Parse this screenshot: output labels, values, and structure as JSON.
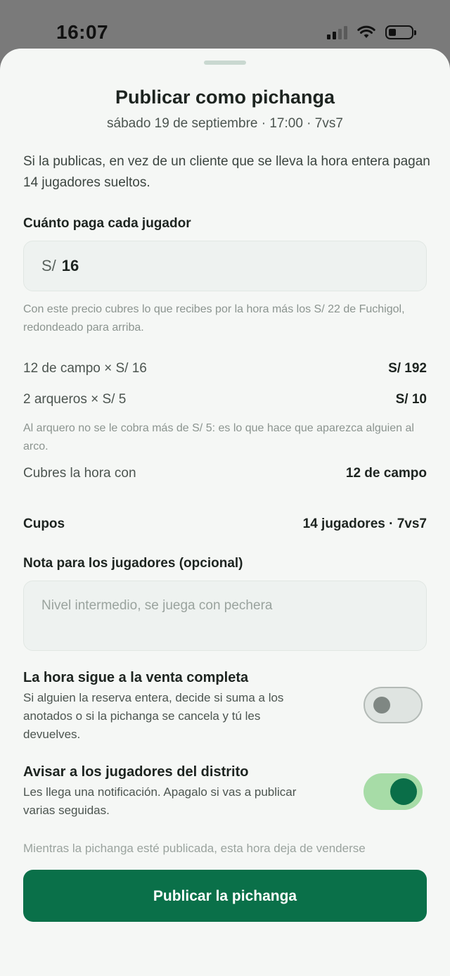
{
  "status": {
    "time": "16:07",
    "icons": [
      "signal-icon",
      "wifi-icon",
      "battery-icon"
    ]
  },
  "sheet": {
    "title": "Publicar como pichanga",
    "subtitle": "sábado 19 de septiembre · 17:00 · 7vs7",
    "intro": "Si la publicas, en vez de un cliente que se lleva la hora entera pagan 14 jugadores sueltos.",
    "price": {
      "label": "Cuánto paga cada jugador",
      "prefix": "S/",
      "value": "16",
      "help": "Con este precio cubres lo que recibes por la hora más los S/ 22 de Fuchigol, redondeado para arriba."
    },
    "breakdown": {
      "field_label": "12 de campo × S/ 16",
      "field_total": "S/ 192",
      "keepers_label": "2 arqueros × S/ 5",
      "keepers_total": "S/ 10",
      "keeper_help": "Al arquero no se le cobra más de S/ 5: es lo que hace que aparezca alguien al arco.",
      "cover_label": "Cubres la hora con",
      "cover_value": "12 de campo"
    },
    "spots": {
      "label": "Cupos",
      "value": "14 jugadores · 7vs7"
    },
    "note": {
      "label": "Nota para los jugadores (opcional)",
      "placeholder": "Nivel intermedio, se juega con pechera"
    },
    "toggles": [
      {
        "title": "La hora sigue a la venta completa",
        "desc": "Si alguien la reserva entera, decide si suma a los anotados o si la pichanga se cancela y tú les devuelves.",
        "state": "off"
      },
      {
        "title": "Avisar a los jugadores del distrito",
        "desc": "Les llega una notificación. Apagalo si vas a publicar varias seguidas.",
        "state": "on"
      }
    ],
    "footer_note": "Mientras la pichanga esté publicada, esta hora deja de venderse",
    "cta": "Publicar la pichanga"
  },
  "colors": {
    "accent": "#0a7049",
    "toggle_on_track": "#a7dca7",
    "toggle_on_knob": "#0a6e48",
    "background": "#f5f7f5"
  }
}
